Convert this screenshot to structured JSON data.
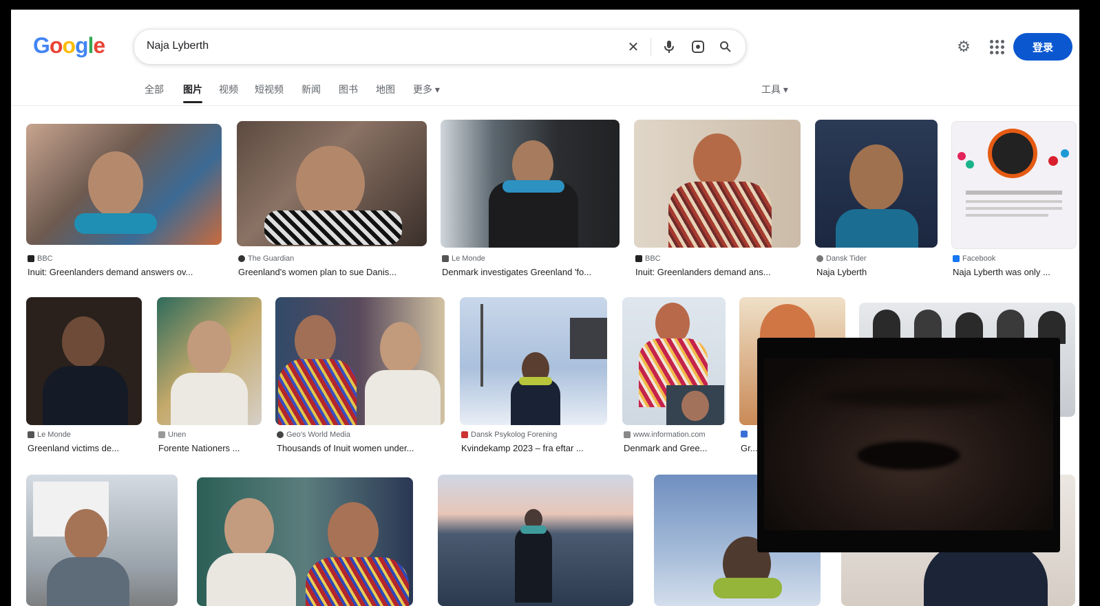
{
  "logo": [
    "G",
    "o",
    "o",
    "g",
    "l",
    "e"
  ],
  "search": {
    "query": "Naja Lyberth"
  },
  "icons": {
    "clear": "close-icon",
    "voice": "mic-icon",
    "lens": "lens-icon",
    "search": "search-icon",
    "settings": "gear-icon",
    "apps": "apps-grid-icon"
  },
  "header": {
    "signin_label": "登录"
  },
  "tabs": [
    "全部",
    "图片",
    "视频",
    "短视频",
    "新闻",
    "图书",
    "地图",
    "更多"
  ],
  "tools_label": "工具",
  "results": [
    {
      "source": "BBC",
      "caption": "Inuit: Greenlanders demand answers ov..."
    },
    {
      "source": "The Guardian",
      "caption": "Greenland's women plan to sue Danis..."
    },
    {
      "source": "Le Monde",
      "caption": "Denmark investigates Greenland 'fo..."
    },
    {
      "source": "BBC",
      "caption": "Inuit: Greenlanders demand ans..."
    },
    {
      "source": "Dansk Tider",
      "caption": "Naja Lyberth"
    },
    {
      "source": "Facebook",
      "caption": "Naja Lyberth was only ..."
    },
    {
      "source": "Le Monde",
      "caption": "Greenland victims de..."
    },
    {
      "source": "Unen",
      "caption": "Forente Nationers ..."
    },
    {
      "source": "Geo's World Media",
      "caption": "Thousands of Inuit women under..."
    },
    {
      "source": "Dansk Psykolog Forening",
      "caption": "Kvindekamp 2023 – fra eftar ..."
    },
    {
      "source": "www.information.com",
      "caption": "Denmark and Gree..."
    },
    {
      "source": "",
      "caption": "Gr..."
    }
  ]
}
